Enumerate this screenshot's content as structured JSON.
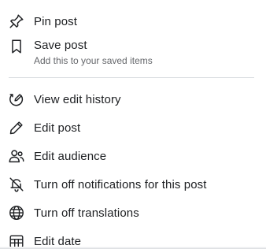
{
  "menu": {
    "pin": {
      "label": "Pin post",
      "icon": "pin-icon"
    },
    "save": {
      "label": "Save post",
      "sublabel": "Add this to your saved items",
      "icon": "bookmark-icon"
    },
    "history": {
      "label": "View edit history",
      "icon": "edit-history-icon"
    },
    "edit": {
      "label": "Edit post",
      "icon": "pencil-icon"
    },
    "audience": {
      "label": "Edit audience",
      "icon": "people-icon"
    },
    "notifications": {
      "label": "Turn off notifications for this post",
      "icon": "bell-off-icon"
    },
    "translations": {
      "label": "Turn off translations",
      "icon": "globe-icon"
    },
    "date": {
      "label": "Edit date",
      "icon": "calendar-icon"
    }
  },
  "colors": {
    "text": "#1c1e21",
    "secondary_text": "#65676b",
    "divider": "#dadde1"
  }
}
